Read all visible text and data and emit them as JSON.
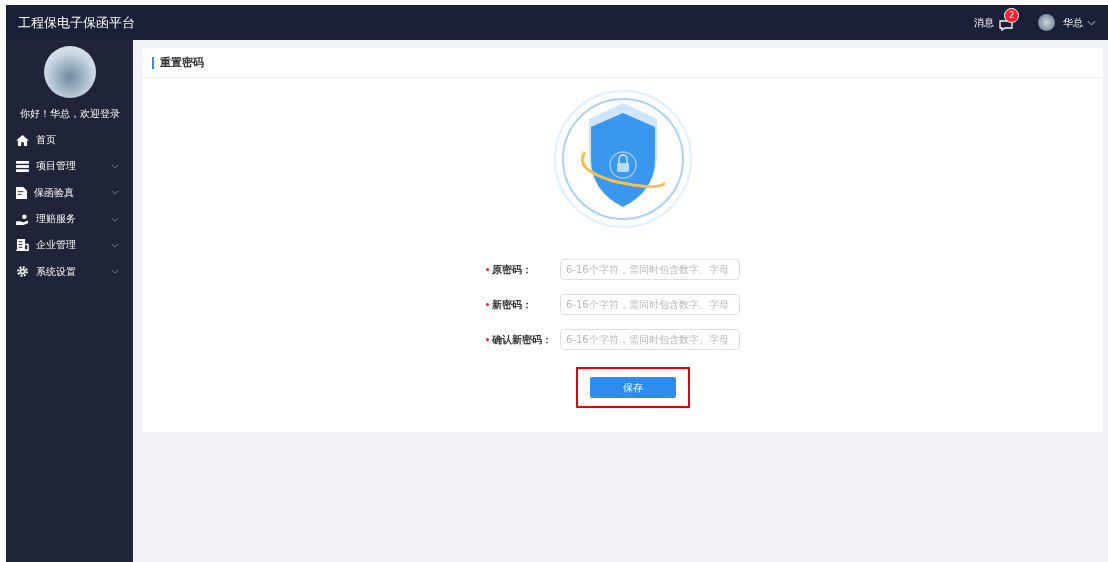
{
  "header": {
    "title": "工程保电子保函平台",
    "messages_label": "消息",
    "message_count": "2",
    "user_name": "华总"
  },
  "sidebar": {
    "greeting": "你好！华总，欢迎登录",
    "items": [
      {
        "label": "首页",
        "kind": "home",
        "expandable": false
      },
      {
        "label": "项目管理",
        "kind": "list",
        "expandable": true
      },
      {
        "label": "保函验真",
        "kind": "doc",
        "expandable": true
      },
      {
        "label": "理赔服务",
        "kind": "hand",
        "expandable": true
      },
      {
        "label": "企业管理",
        "kind": "building",
        "expandable": true
      },
      {
        "label": "系统设置",
        "kind": "gear",
        "expandable": true
      }
    ]
  },
  "card": {
    "title": "重置密码",
    "fields": [
      {
        "label": "原密码：",
        "required": true,
        "placeholder": "6-16个字符，需同时包含数字、字母"
      },
      {
        "label": "新密码：",
        "required": true,
        "placeholder": "6-16个字符，需同时包含数字、字母"
      },
      {
        "label": "确认新密码：",
        "required": true,
        "placeholder": "6-16个字符，需同时包含数字、字母"
      }
    ],
    "save_button": {
      "label": "保存",
      "highlighted": true
    }
  }
}
